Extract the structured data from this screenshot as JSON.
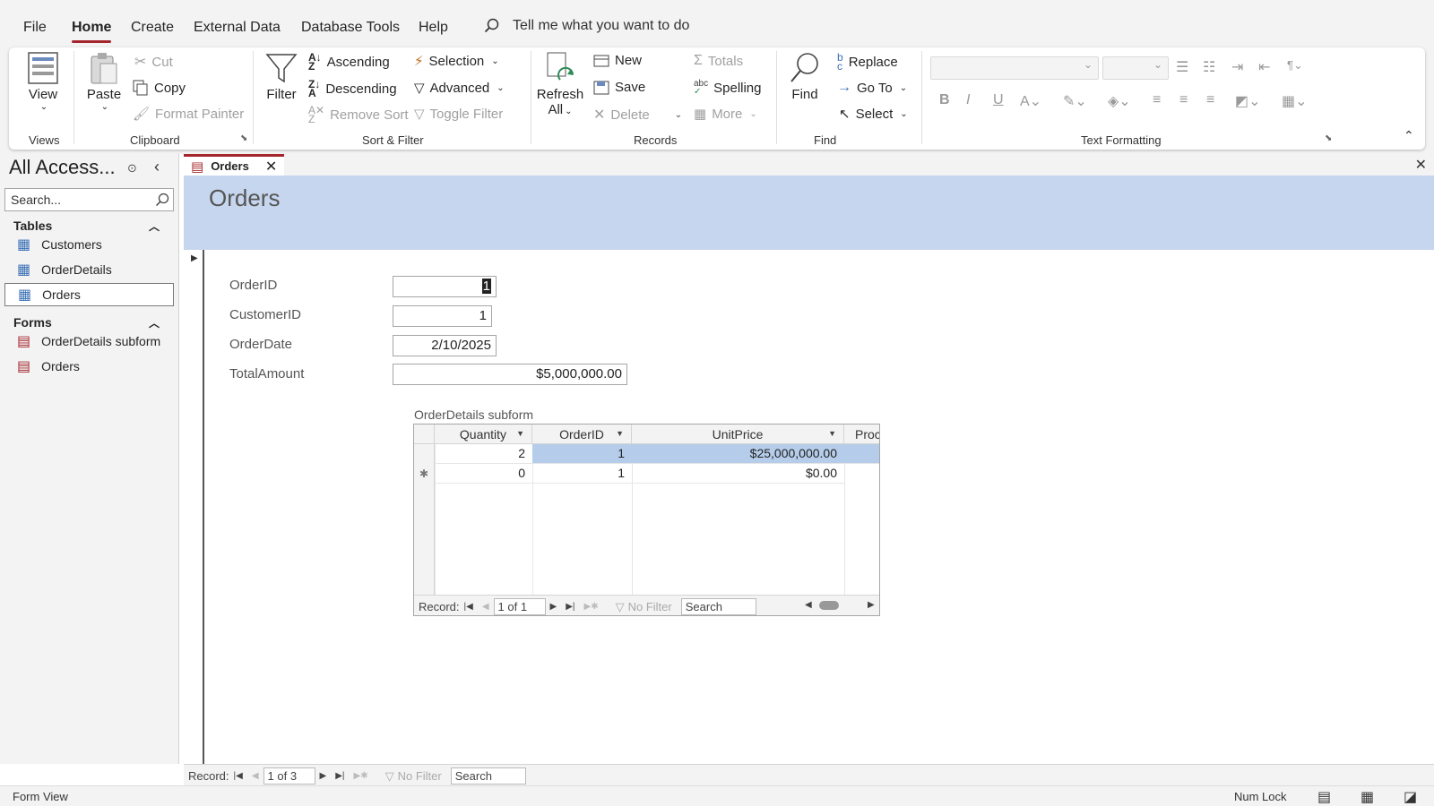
{
  "menu": {
    "tabs": [
      "File",
      "Home",
      "Create",
      "External Data",
      "Database Tools",
      "Help"
    ],
    "active": "Home",
    "tell_me": "Tell me what you want to do"
  },
  "ribbon": {
    "views": {
      "view": "View",
      "group": "Views"
    },
    "clipboard": {
      "paste": "Paste",
      "cut": "Cut",
      "copy": "Copy",
      "format_painter": "Format Painter",
      "group": "Clipboard"
    },
    "sort_filter": {
      "filter": "Filter",
      "ascending": "Ascending",
      "descending": "Descending",
      "remove_sort": "Remove Sort",
      "selection": "Selection",
      "advanced": "Advanced",
      "toggle_filter": "Toggle Filter",
      "group": "Sort & Filter"
    },
    "records": {
      "refresh": "Refresh",
      "refresh_all": "All",
      "new": "New",
      "save": "Save",
      "delete": "Delete",
      "totals": "Totals",
      "spelling": "Spelling",
      "more": "More",
      "group": "Records"
    },
    "find": {
      "find": "Find",
      "replace": "Replace",
      "goto": "Go To",
      "select": "Select",
      "group": "Find"
    },
    "text_formatting": {
      "group": "Text Formatting"
    }
  },
  "nav_pane": {
    "title": "All Access...",
    "search_placeholder": "Search...",
    "tables_header": "Tables",
    "tables": [
      "Customers",
      "OrderDetails",
      "Orders"
    ],
    "forms_header": "Forms",
    "forms": [
      "OrderDetails subform",
      "Orders"
    ],
    "selected": "Orders"
  },
  "document": {
    "tab": "Orders",
    "form_title": "Orders",
    "fields": [
      {
        "label": "OrderID",
        "value": "1"
      },
      {
        "label": "CustomerID",
        "value": "1"
      },
      {
        "label": "OrderDate",
        "value": "2/10/2025"
      },
      {
        "label": "TotalAmount",
        "value": "$5,000,000.00"
      }
    ]
  },
  "subform": {
    "label": "OrderDetails subform",
    "columns": [
      "Quantity",
      "OrderID",
      "UnitPrice",
      "Proc"
    ],
    "rows": [
      [
        "2",
        "1",
        "$25,000,000.00"
      ],
      [
        "0",
        "1",
        "$0.00"
      ]
    ],
    "new_row_marker": "✱",
    "nav": {
      "record_label": "Record:",
      "position": "1 of 1",
      "no_filter": "No Filter",
      "search": "Search"
    }
  },
  "main_nav": {
    "record_label": "Record:",
    "position": "1 of 3",
    "no_filter": "No Filter",
    "search": "Search"
  },
  "status": {
    "view": "Form View",
    "num_lock": "Num Lock"
  },
  "colors": {
    "accent": "#a4262c",
    "header": "#c6d6ee",
    "highlight": "#b5cdea"
  }
}
